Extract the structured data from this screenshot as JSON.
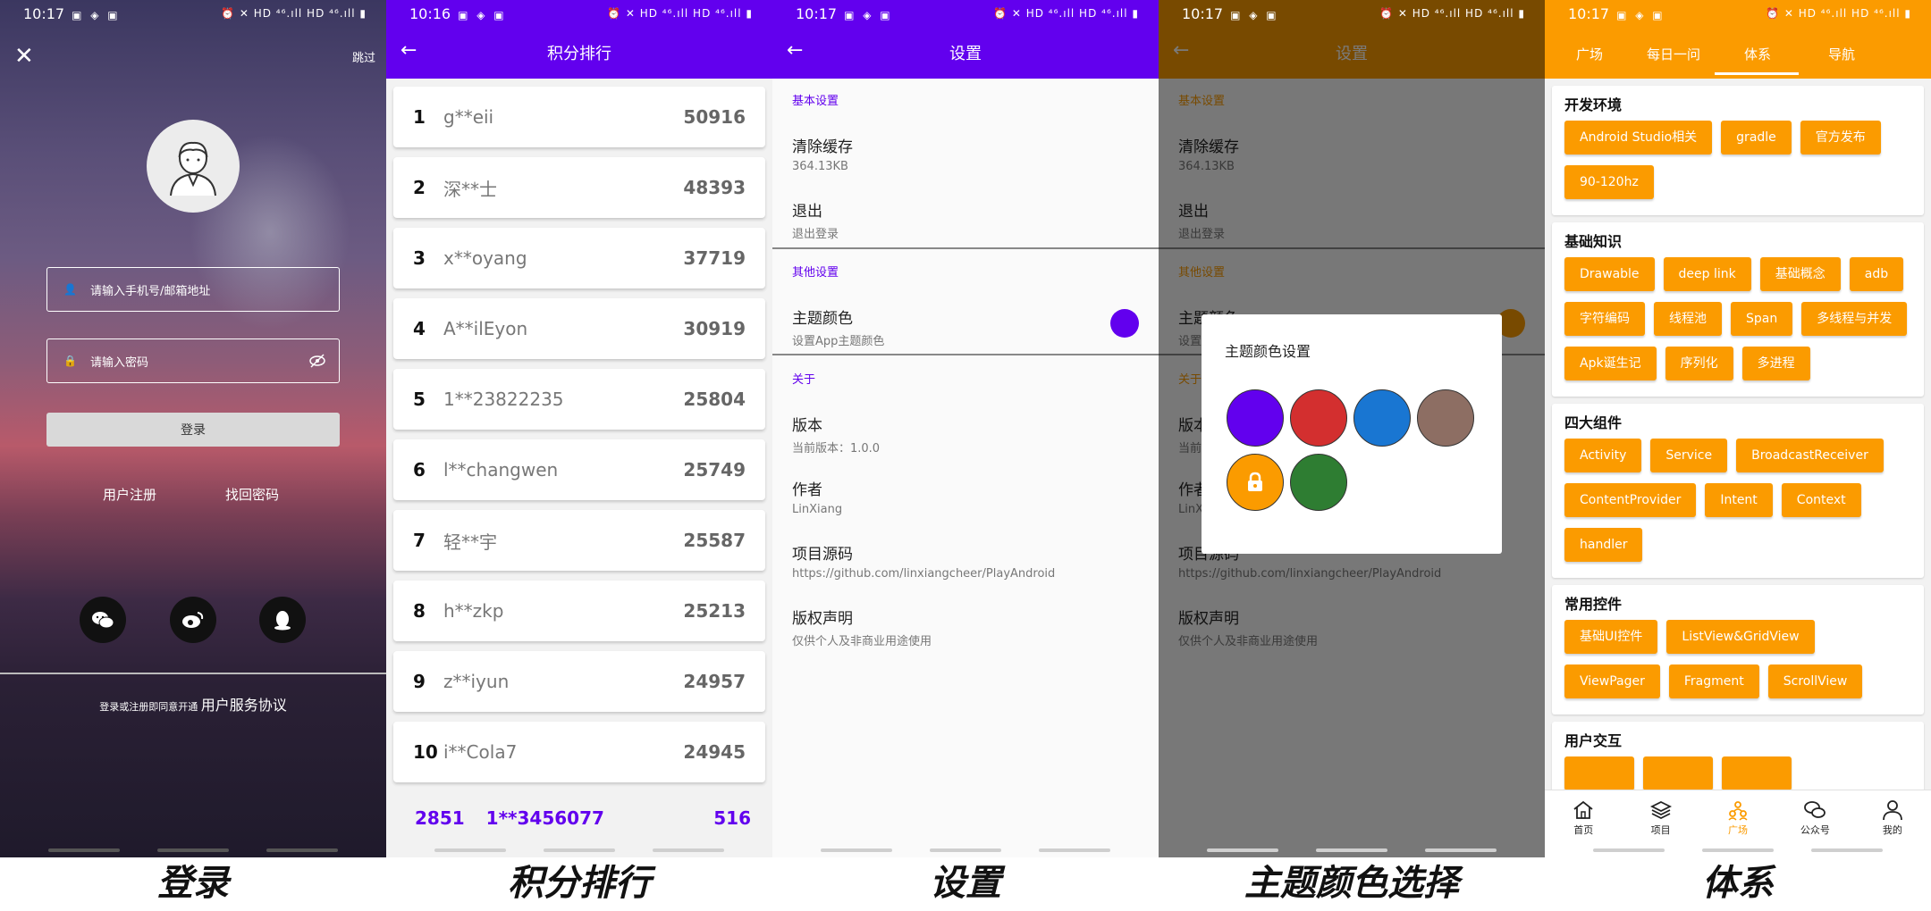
{
  "status": {
    "time_login": "10:17",
    "time_rank": "10:16",
    "time_settings": "10:17",
    "time_theme": "10:17",
    "time_system": "10:17",
    "net_text": "HD ⁴⁶.ıll HD ⁴⁶.ıll"
  },
  "login": {
    "skip": "跳过",
    "phone_placeholder": "请输入手机号/邮箱地址",
    "password_placeholder": "请输入密码",
    "login_button": "登录",
    "register_link": "用户注册",
    "forgot_link": "找回密码",
    "agree_prefix": "登录或注册即同意开通",
    "agree_link": "用户服务协议"
  },
  "ranking": {
    "title": "积分排行",
    "rows": [
      {
        "rank": "1",
        "name": "g**eii",
        "score": "50916"
      },
      {
        "rank": "2",
        "name": "深**士",
        "score": "48393"
      },
      {
        "rank": "3",
        "name": "x**oyang",
        "score": "37719"
      },
      {
        "rank": "4",
        "name": "A**ilEyon",
        "score": "30919"
      },
      {
        "rank": "5",
        "name": "1**23822235",
        "score": "25804"
      },
      {
        "rank": "6",
        "name": "l**changwen",
        "score": "25749"
      },
      {
        "rank": "7",
        "name": "轻**宇",
        "score": "25587"
      },
      {
        "rank": "8",
        "name": "h**zkp",
        "score": "25213"
      },
      {
        "rank": "9",
        "name": "z**iyun",
        "score": "24957"
      },
      {
        "rank": "10",
        "name": "i**Cola7",
        "score": "24945"
      }
    ],
    "mine": {
      "rank": "2851",
      "name": "1**3456077",
      "score": "516"
    }
  },
  "settings": {
    "title": "设置",
    "basic": "基本设置",
    "clear_cache": "清除缓存",
    "cache_size": "364.13KB",
    "logout": "退出",
    "logout_sub": "退出登录",
    "other": "其他设置",
    "theme_color": "主题颜色",
    "theme_color_sub": "设置App主题颜色",
    "about": "关于",
    "version": "版本",
    "version_sub": "当前版本：1.0.0",
    "author": "作者",
    "author_sub": "LinXiang",
    "source": "项目源码",
    "source_sub": "https://github.com/linxiangcheer/PlayAndroid",
    "copyright": "版权声明",
    "copyright_sub": "仅供个人及非商业用途使用"
  },
  "theme_dialog": {
    "title": "主题颜色设置",
    "colors": [
      "#6200ee",
      "#d32f2f",
      "#1976d2",
      "#8d6e63",
      "#fb9b00",
      "#2e7d32"
    ]
  },
  "system": {
    "tabs": [
      "广场",
      "每日一问",
      "体系",
      "导航"
    ],
    "groups": [
      {
        "title": "开发环境",
        "chips": [
          "Android Studio相关",
          "gradle",
          "官方发布",
          "90-120hz"
        ]
      },
      {
        "title": "基础知识",
        "chips": [
          "Drawable",
          "deep link",
          "基础概念",
          "adb",
          "字符编码",
          "线程池",
          "Span",
          "多线程与并发",
          "Apk诞生记",
          "序列化",
          "多进程"
        ]
      },
      {
        "title": "四大组件",
        "chips": [
          "Activity",
          "Service",
          "BroadcastReceiver",
          "ContentProvider",
          "Intent",
          "Context",
          "handler"
        ]
      },
      {
        "title": "常用控件",
        "chips": [
          "基础UI控件",
          "ListView&GridView",
          "ViewPager",
          "Fragment",
          "ScrollView"
        ]
      },
      {
        "title": "用户交互",
        "chips": [
          "",
          "",
          ""
        ]
      }
    ],
    "bottom_nav": [
      "首页",
      "项目",
      "广场",
      "公众号",
      "我的"
    ]
  },
  "captions": {
    "login": "登录",
    "ranking": "积分排行",
    "settings": "设置",
    "theme": "主题颜色选择",
    "system": "体系"
  },
  "colors": {
    "primary_purple": "#6200ee",
    "primary_orange": "#fb9b00"
  }
}
